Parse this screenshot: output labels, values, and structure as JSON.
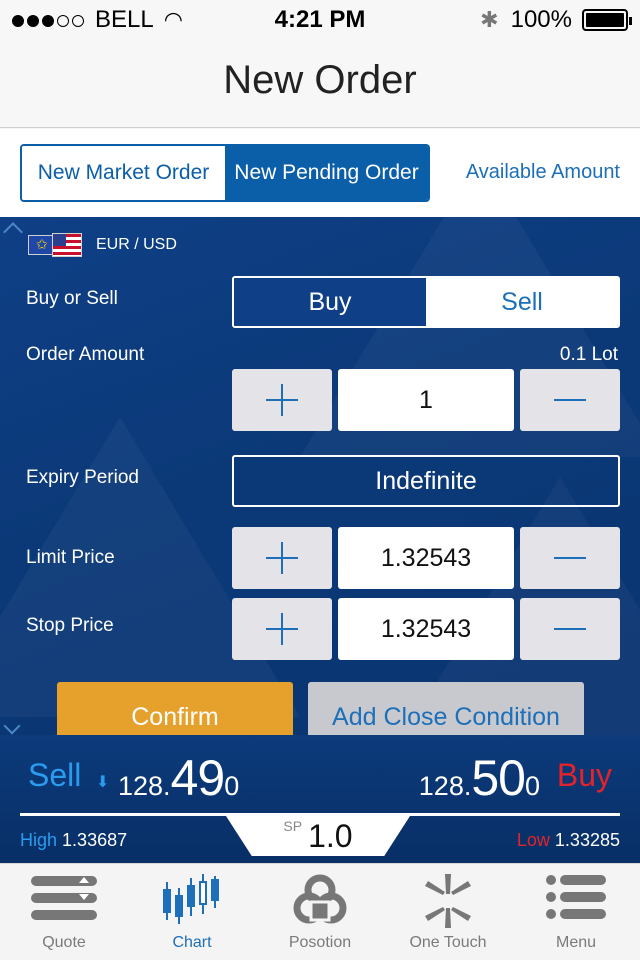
{
  "status_bar": {
    "carrier": "BELL",
    "time": "4:21 PM",
    "battery": "100%"
  },
  "nav": {
    "title": "New Order"
  },
  "order_tabs": {
    "market": "New Market Order",
    "pending": "New Pending Order",
    "available": "Available Amount"
  },
  "instrument": {
    "pair": "EUR / USD"
  },
  "form": {
    "buy_or_sell_label": "Buy or Sell",
    "buy": "Buy",
    "sell": "Sell",
    "order_amount_label": "Order Amount",
    "lot_unit": "0.1 Lot",
    "amount_value": "1",
    "expiry_label": "Expiry Period",
    "expiry_value": "Indefinite",
    "limit_label": "Limit Price",
    "limit_value": "1.32543",
    "stop_label": "Stop Price",
    "stop_value": "1.32543",
    "confirm": "Confirm",
    "add_close": "Add Close Condition"
  },
  "quote": {
    "sell_label": "Sell",
    "buy_label": "Buy",
    "sell_small": "128.",
    "sell_big": "49",
    "sell_tail": "0",
    "buy_small": "128.",
    "buy_big": "50",
    "buy_tail": "0",
    "sp_label": "SP",
    "sp_value": "1.0",
    "high_label": "High",
    "high_value": "1.33687",
    "low_label": "Low",
    "low_value": "1.33285"
  },
  "tabbar": {
    "quote": "Quote",
    "chart": "Chart",
    "position": "Posotion",
    "onetouch": "One Touch",
    "menu": "Menu"
  },
  "colors": {
    "brand_blue": "#0b5ea8",
    "panel": "#0b3978",
    "confirm": "#e5a12c",
    "sell_blue": "#2b9bf0",
    "buy_red": "#e3232b"
  },
  "icons": [
    "signal-dots-icon",
    "wifi-icon",
    "bluetooth-icon",
    "battery-icon",
    "plus-icon",
    "minus-icon",
    "quote-icon",
    "chart-icon",
    "position-icon",
    "one-touch-icon",
    "menu-icon"
  ]
}
